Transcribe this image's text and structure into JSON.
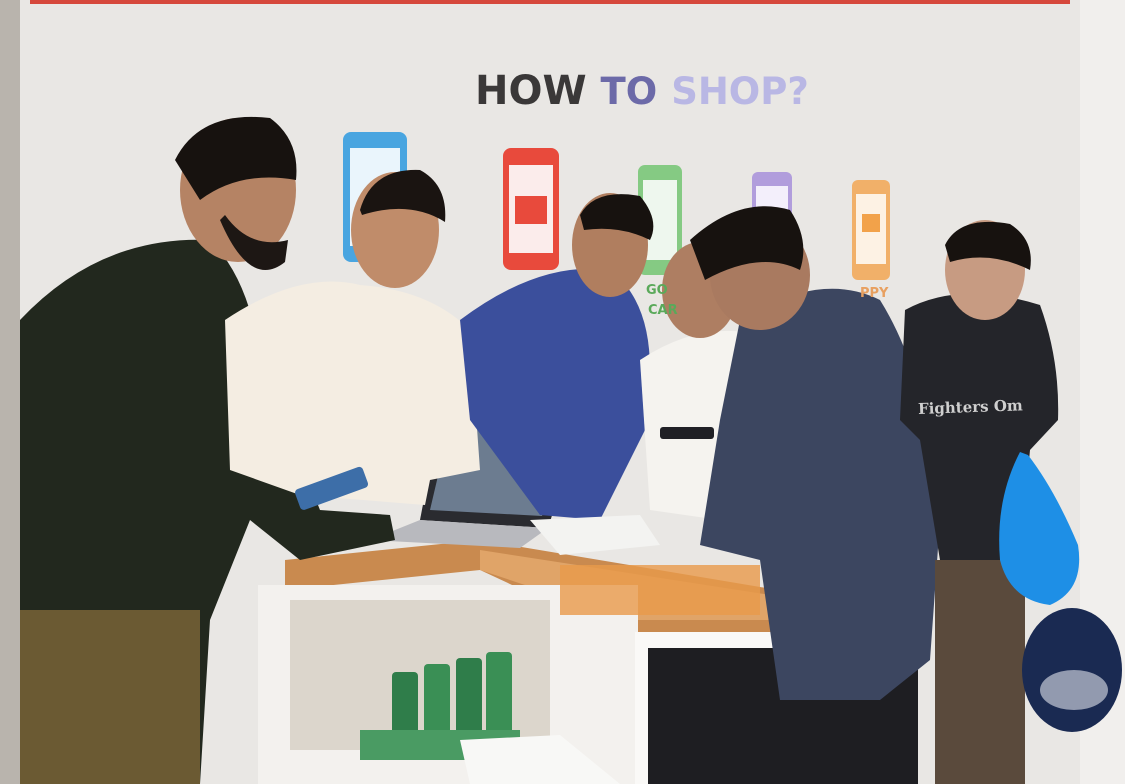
{
  "wall_sign": {
    "part1": "HOW",
    "part2": "TO",
    "part3": "SHOP?"
  },
  "wall_fragments": {
    "go": "GO",
    "cart": "CAR",
    "happy": "PPY"
  },
  "shirt_print": "Fighters Om",
  "colors": {
    "wall": "#ecebea",
    "phone_blue": "#49a5e0",
    "phone_red": "#e84a3c",
    "phone_green": "#6bc36a",
    "phone_purple": "#9d84d9",
    "phone_orange": "#f2a24a",
    "counter_wood": "#c98a4f",
    "bag_blue": "#1e8fe6"
  }
}
